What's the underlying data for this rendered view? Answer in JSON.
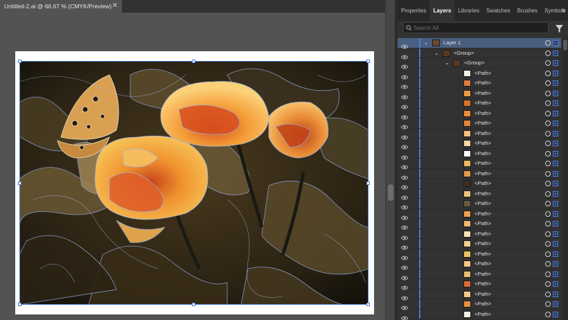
{
  "document": {
    "tab_title": "Untitled-2.ai @ 66.67 % (CMYK/Preview)",
    "close_glyph": "✕"
  },
  "panel": {
    "tabs": [
      "Properties",
      "Layers",
      "Libraries",
      "Swatches",
      "Brushes",
      "Symbols"
    ],
    "active_tab": "Layers",
    "menu_glyph": "≡",
    "search_placeholder": "Search All"
  },
  "layers": [
    {
      "name": "Layer 1",
      "indent": 0,
      "expanded": true,
      "selected": true,
      "thumb": "#6b4a2a"
    },
    {
      "name": "<Group>",
      "indent": 1,
      "expanded": true,
      "selected": false,
      "thumb": "#5a3a22"
    },
    {
      "name": "<Group>",
      "indent": 2,
      "expanded": true,
      "selected": false,
      "thumb": "#5a3a22"
    },
    {
      "name": "<Path>",
      "indent": 3,
      "thumb": "#f4efe6"
    },
    {
      "name": "<Path>",
      "indent": 3,
      "thumb": "#e07a3a"
    },
    {
      "name": "<Path>",
      "indent": 3,
      "thumb": "#ef9a4a"
    },
    {
      "name": "<Path>",
      "indent": 3,
      "thumb": "#d9702c"
    },
    {
      "name": "<Path>",
      "indent": 3,
      "thumb": "#f08c38"
    },
    {
      "name": "<Path>",
      "indent": 3,
      "thumb": "#e8843c"
    },
    {
      "name": "<Path>",
      "indent": 3,
      "thumb": "#f5c27a"
    },
    {
      "name": "<Path>",
      "indent": 3,
      "thumb": "#f7d9a8"
    },
    {
      "name": "<Path>",
      "indent": 3,
      "thumb": "#ffffff"
    },
    {
      "name": "<Path>",
      "indent": 3,
      "thumb": "#f0b860"
    },
    {
      "name": "<Path>",
      "indent": 3,
      "thumb": "#e89a48"
    },
    {
      "name": "<Path>",
      "indent": 3,
      "thumb": "#3a3020"
    },
    {
      "name": "<Path>",
      "indent": 3,
      "thumb": "#f2c47a"
    },
    {
      "name": "<Path>",
      "indent": 3,
      "thumb": "#6a5a3a"
    },
    {
      "name": "<Path>",
      "indent": 3,
      "thumb": "#f0a050"
    },
    {
      "name": "<Path>",
      "indent": 3,
      "thumb": "#f5b870"
    },
    {
      "name": "<Path>",
      "indent": 3,
      "thumb": "#fbe3b8"
    },
    {
      "name": "<Path>",
      "indent": 3,
      "thumb": "#f2d090"
    },
    {
      "name": "<Path>",
      "indent": 3,
      "thumb": "#f0c060"
    },
    {
      "name": "<Path>",
      "indent": 3,
      "thumb": "#f7c880"
    },
    {
      "name": "<Path>",
      "indent": 3,
      "thumb": "#e8c070"
    },
    {
      "name": "<Path>",
      "indent": 3,
      "thumb": "#e06a30"
    },
    {
      "name": "<Path>",
      "indent": 3,
      "thumb": "#f4cc88"
    },
    {
      "name": "<Path>",
      "indent": 3,
      "thumb": "#e89040"
    },
    {
      "name": "<Path>",
      "indent": 3,
      "thumb": "#f6f0e6"
    }
  ],
  "colors": {
    "layer_color": "#4c79d6",
    "selection_row": "#4a5f80"
  }
}
